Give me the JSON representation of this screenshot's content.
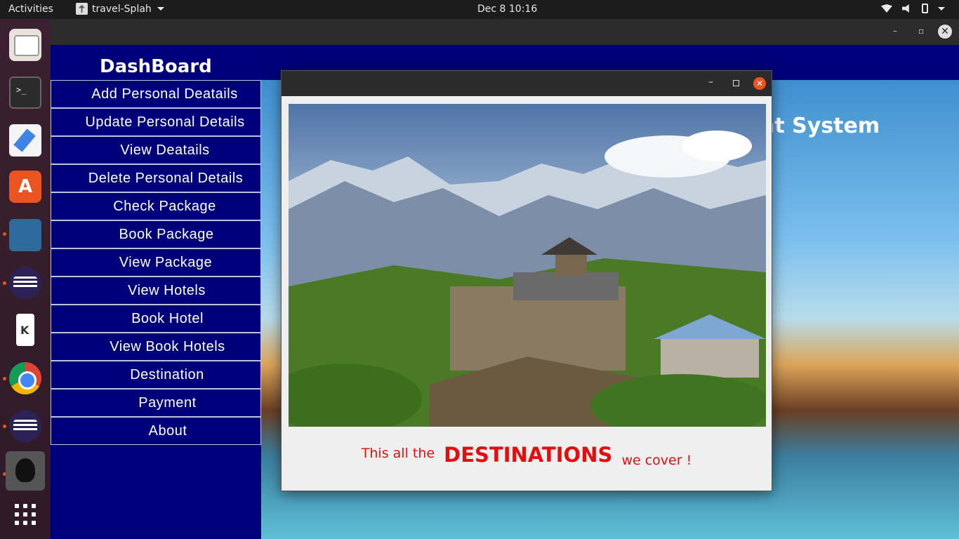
{
  "topbar": {
    "activities": "Activities",
    "app_name": "travel-Splah",
    "clock": "Dec 8  10:16"
  },
  "dock": {
    "items": [
      "files-icon",
      "terminal-icon",
      "text-editor-icon",
      "app-store-icon",
      "mysql-workbench-icon",
      "eclipse-icon",
      "kde-connect-icon",
      "chrome-icon",
      "eclipse-icon",
      "java-app-icon",
      "show-apps-icon"
    ]
  },
  "main": {
    "window_min": "–",
    "window_max": "▫",
    "window_close": "✕",
    "dashboard_title": "DashBoard",
    "background_title": "nt System",
    "menu": [
      "Add Personal Deatails",
      "Update Personal Details",
      "View Deatails",
      "Delete Personal Details",
      "Check Package",
      "Book Package",
      "View Package",
      "View Hotels",
      "Book Hotel",
      "View Book Hotels",
      "Destination",
      "Payment",
      "About"
    ]
  },
  "dialog": {
    "min": "–",
    "close": "✕",
    "caption_prefix": "This all the",
    "caption_highlight": "DESTINATIONS",
    "caption_suffix": "we cover !"
  },
  "colors": {
    "menu_bg": "#00007a",
    "caption": "#e01010",
    "close_button": "#e95420"
  }
}
